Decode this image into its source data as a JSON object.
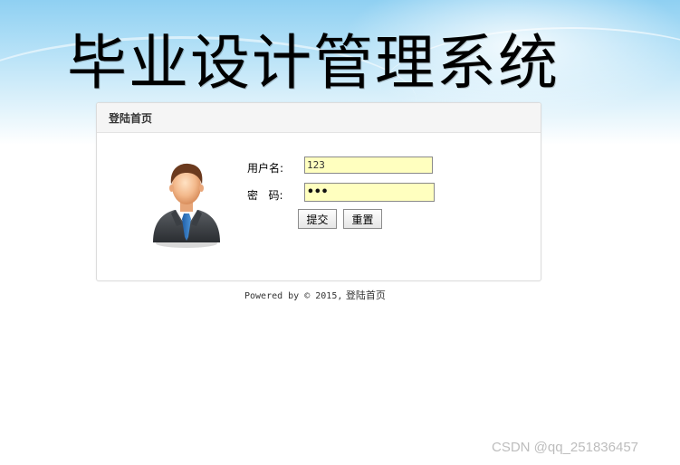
{
  "header": {
    "title": "毕业设计管理系统"
  },
  "login_panel": {
    "title": "登陆首页",
    "username_label": "用户名:",
    "password_label": "密   码:",
    "username_value": "123",
    "password_value": "•••",
    "submit_label": "提交",
    "reset_label": "重置",
    "avatar_icon": "user-avatar-icon",
    "input_bg_color": "#ffffbf"
  },
  "footer": {
    "powered_by": "Powered by © 2015,",
    "site_name": "登陆首页"
  },
  "watermark": {
    "text": "CSDN @qq_251836457"
  }
}
